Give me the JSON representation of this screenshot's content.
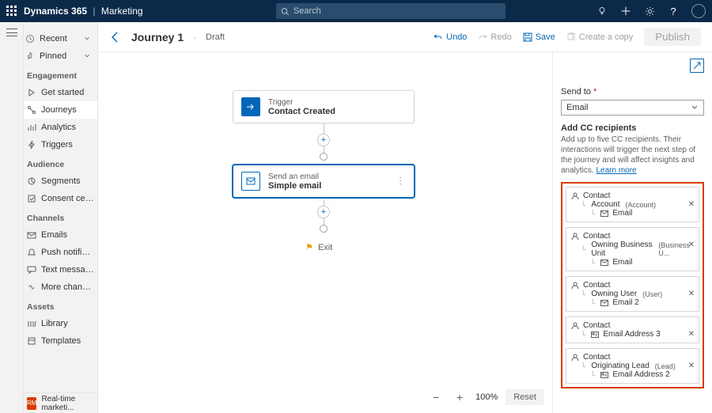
{
  "brand": {
    "product": "Dynamics 365",
    "module": "Marketing"
  },
  "search": {
    "placeholder": "Search"
  },
  "sidebar": {
    "recent": "Recent",
    "pinned": "Pinned",
    "groups": {
      "engagement": "Engagement",
      "audience": "Audience",
      "channels": "Channels",
      "assets": "Assets"
    },
    "items": {
      "get_started": "Get started",
      "journeys": "Journeys",
      "analytics": "Analytics",
      "triggers": "Triggers",
      "segments": "Segments",
      "consent_center": "Consent center",
      "emails": "Emails",
      "push": "Push notifications",
      "text": "Text messages",
      "more_channels": "More channels",
      "library": "Library",
      "templates": "Templates"
    },
    "footer_badge": "RM",
    "footer_label": "Real-time marketi..."
  },
  "page": {
    "title": "Journey 1",
    "status": "Draft"
  },
  "commands": {
    "undo": "Undo",
    "redo": "Redo",
    "save": "Save",
    "create_copy": "Create a copy",
    "publish": "Publish"
  },
  "canvas": {
    "trigger": {
      "label": "Trigger",
      "value": "Contact Created"
    },
    "email": {
      "label": "Send an email",
      "value": "Simple email"
    },
    "exit": "Exit",
    "zoom": "100%",
    "reset": "Reset"
  },
  "panel": {
    "send_to_label": "Send to",
    "send_to_value": "Email",
    "cc_title": "Add CC recipients",
    "cc_help": "Add up to five CC recipients. Their interactions will trigger the next step of the journey and will affect insights and analytics.",
    "learn_more": "Learn more",
    "cc": [
      {
        "entity": "Contact",
        "path": "Account",
        "path_sub": "(Account)",
        "field": "Email",
        "field_icon": "mail"
      },
      {
        "entity": "Contact",
        "path": "Owning Business Unit",
        "path_sub": "(Business U...",
        "field": "Email",
        "field_icon": "mail"
      },
      {
        "entity": "Contact",
        "path": "Owning User",
        "path_sub": "(User)",
        "field": "Email 2",
        "field_icon": "mail"
      },
      {
        "entity": "Contact",
        "path": "",
        "path_sub": "",
        "field": "Email Address 3",
        "field_icon": "id"
      },
      {
        "entity": "Contact",
        "path": "Originating Lead",
        "path_sub": "(Lead)",
        "field": "Email Address 2",
        "field_icon": "id"
      }
    ]
  }
}
